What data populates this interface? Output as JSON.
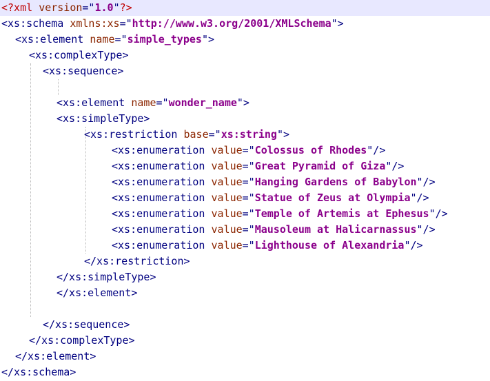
{
  "editor": {
    "lines": [
      {
        "segments": [
          {
            "t": "pi",
            "v": "<?xml "
          },
          {
            "t": "attr",
            "v": "version"
          },
          {
            "t": "punct",
            "v": "=\""
          },
          {
            "t": "val",
            "v": "1.0"
          },
          {
            "t": "punct",
            "v": "\""
          },
          {
            "t": "pi",
            "v": "?>"
          }
        ]
      },
      {
        "segments": [
          {
            "t": "tag",
            "v": "<xs:schema "
          },
          {
            "t": "attr",
            "v": "xmlns:xs"
          },
          {
            "t": "punct",
            "v": "=\""
          },
          {
            "t": "val",
            "v": "http://www.w3.org/2001/XMLSchema"
          },
          {
            "t": "punct",
            "v": "\">"
          }
        ]
      },
      {
        "segments": [
          {
            "t": "tag",
            "v": "<xs:element "
          },
          {
            "t": "attr",
            "v": "name"
          },
          {
            "t": "punct",
            "v": "=\""
          },
          {
            "t": "val",
            "v": "simple_types"
          },
          {
            "t": "punct",
            "v": "\">"
          }
        ]
      },
      {
        "segments": [
          {
            "t": "tag",
            "v": "<xs:complexType>"
          }
        ]
      },
      {
        "segments": [
          {
            "t": "tag",
            "v": "<xs:sequence>"
          }
        ]
      },
      {
        "segments": []
      },
      {
        "segments": [
          {
            "t": "tag",
            "v": "<xs:element "
          },
          {
            "t": "attr",
            "v": "name"
          },
          {
            "t": "punct",
            "v": "=\""
          },
          {
            "t": "val",
            "v": "wonder_name"
          },
          {
            "t": "punct",
            "v": "\">"
          }
        ]
      },
      {
        "segments": [
          {
            "t": "tag",
            "v": "<xs:simpleType>"
          }
        ]
      },
      {
        "segments": [
          {
            "t": "tag",
            "v": "<xs:restriction "
          },
          {
            "t": "attr",
            "v": "base"
          },
          {
            "t": "punct",
            "v": "=\""
          },
          {
            "t": "val",
            "v": "xs:string"
          },
          {
            "t": "punct",
            "v": "\">"
          }
        ]
      },
      {
        "segments": [
          {
            "t": "tag",
            "v": "<xs:enumeration "
          },
          {
            "t": "attr",
            "v": "value"
          },
          {
            "t": "punct",
            "v": "=\""
          },
          {
            "t": "val",
            "v": "Colossus of Rhodes"
          },
          {
            "t": "punct",
            "v": "\"/>"
          }
        ]
      },
      {
        "segments": [
          {
            "t": "tag",
            "v": "<xs:enumeration "
          },
          {
            "t": "attr",
            "v": "value"
          },
          {
            "t": "punct",
            "v": "=\""
          },
          {
            "t": "val",
            "v": "Great Pyramid of Giza"
          },
          {
            "t": "punct",
            "v": "\"/>"
          }
        ]
      },
      {
        "segments": [
          {
            "t": "tag",
            "v": "<xs:enumeration "
          },
          {
            "t": "attr",
            "v": "value"
          },
          {
            "t": "punct",
            "v": "=\""
          },
          {
            "t": "val",
            "v": "Hanging Gardens of Babylon"
          },
          {
            "t": "punct",
            "v": "\"/>"
          }
        ]
      },
      {
        "segments": [
          {
            "t": "tag",
            "v": "<xs:enumeration "
          },
          {
            "t": "attr",
            "v": "value"
          },
          {
            "t": "punct",
            "v": "=\""
          },
          {
            "t": "val",
            "v": "Statue of Zeus at Olympia"
          },
          {
            "t": "punct",
            "v": "\"/>"
          }
        ]
      },
      {
        "segments": [
          {
            "t": "tag",
            "v": "<xs:enumeration "
          },
          {
            "t": "attr",
            "v": "value"
          },
          {
            "t": "punct",
            "v": "=\""
          },
          {
            "t": "val",
            "v": "Temple of Artemis at Ephesus"
          },
          {
            "t": "punct",
            "v": "\"/>"
          }
        ]
      },
      {
        "segments": [
          {
            "t": "tag",
            "v": "<xs:enumeration "
          },
          {
            "t": "attr",
            "v": "value"
          },
          {
            "t": "punct",
            "v": "=\""
          },
          {
            "t": "val",
            "v": "Mausoleum at Halicarnassus"
          },
          {
            "t": "punct",
            "v": "\"/>"
          }
        ]
      },
      {
        "segments": [
          {
            "t": "tag",
            "v": "<xs:enumeration "
          },
          {
            "t": "attr",
            "v": "value"
          },
          {
            "t": "punct",
            "v": "=\""
          },
          {
            "t": "val",
            "v": "Lighthouse of Alexandria"
          },
          {
            "t": "punct",
            "v": "\"/>"
          }
        ]
      },
      {
        "segments": [
          {
            "t": "tag",
            "v": "</xs:restriction>"
          }
        ]
      },
      {
        "segments": [
          {
            "t": "tag",
            "v": "</xs:simpleType>"
          }
        ]
      },
      {
        "segments": [
          {
            "t": "tag",
            "v": "</xs:element>"
          }
        ]
      },
      {
        "segments": []
      },
      {
        "segments": [
          {
            "t": "tag",
            "v": "</xs:sequence>"
          }
        ]
      },
      {
        "segments": [
          {
            "t": "tag",
            "v": "</xs:complexType>"
          }
        ]
      },
      {
        "segments": [
          {
            "t": "tag",
            "v": "</xs:element>"
          }
        ]
      },
      {
        "segments": [
          {
            "t": "tag",
            "v": "</xs:schema>"
          }
        ]
      }
    ],
    "colors": {
      "current_line": "#e8e8ff",
      "processing_instruction": "#c00000",
      "tag": "#000080",
      "attribute": "#8b2500",
      "value": "#8b008b",
      "indent_guide": "#b8b8b8"
    }
  }
}
